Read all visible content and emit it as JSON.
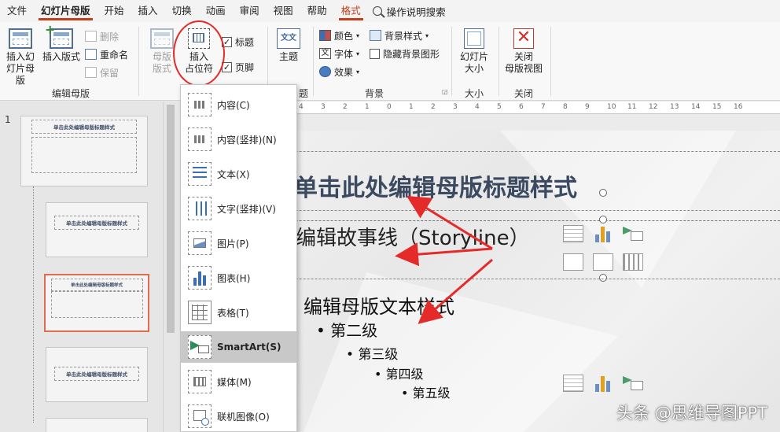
{
  "tabs": [
    "文件",
    "幻灯片母版",
    "开始",
    "插入",
    "切换",
    "动画",
    "审阅",
    "视图",
    "帮助",
    "格式"
  ],
  "active_tab": "幻灯片母版",
  "tell_me": "操作说明搜索",
  "ribbon": {
    "edit_master": {
      "insert_slide_master": "插入幻\n灯片母版",
      "insert_layout": "插入版式",
      "delete": "删除",
      "rename": "重命名",
      "preserve": "保留",
      "label": "编辑母版"
    },
    "master_layout": {
      "master_layout_btn": "母版\n版式",
      "insert_placeholder": "插入\n占位符",
      "title_checkbox": "标题",
      "footer_checkbox": "页脚",
      "title_checked": true,
      "footer_checked": true
    },
    "edit_theme": {
      "themes": "主题",
      "label": "题"
    },
    "background": {
      "colors": "颜色",
      "fonts": "字体",
      "effects": "效果",
      "background_styles": "背景样式",
      "hide_background": "隐藏背景图形",
      "label": "背景"
    },
    "size": {
      "slide_size": "幻灯片\n大小",
      "label": "大小"
    },
    "close": {
      "close_master_view": "关闭\n母版视图",
      "label": "关闭"
    }
  },
  "dropdown_items": [
    {
      "label": "内容(C)",
      "icon": "content-placeholder-icon"
    },
    {
      "label": "内容(竖排)(N)",
      "icon": "vertical-content-placeholder-icon"
    },
    {
      "label": "文本(X)",
      "icon": "text-placeholder-icon"
    },
    {
      "label": "文字(竖排)(V)",
      "icon": "vertical-text-placeholder-icon"
    },
    {
      "label": "图片(P)",
      "icon": "picture-placeholder-icon"
    },
    {
      "label": "图表(H)",
      "icon": "chart-placeholder-icon"
    },
    {
      "label": "表格(T)",
      "icon": "table-placeholder-icon"
    },
    {
      "label": "SmartArt(S)",
      "icon": "smartart-placeholder-icon"
    },
    {
      "label": "媒体(M)",
      "icon": "media-placeholder-icon"
    },
    {
      "label": "联机图像(O)",
      "icon": "online-image-placeholder-icon"
    }
  ],
  "highlighted_item": "SmartArt(S)",
  "slide_panel": {
    "slide_number": "1",
    "thumb_title": "单击此处编辑母版标题样式",
    "thumb_title_2": "单击此处编辑母版标题样式"
  },
  "ruler_ticks": [
    "4",
    "3",
    "2",
    "1",
    "0",
    "1",
    "2",
    "3",
    "4",
    "5",
    "6",
    "7",
    "8",
    "9",
    "10",
    "11",
    "12",
    "13",
    "14",
    "15",
    "16"
  ],
  "slide": {
    "title": "单击此处编辑母版标题样式",
    "storyline": "编辑故事线（Storyline）",
    "level1": "编辑母版文本样式",
    "level2": "第二级",
    "level3": "第三级",
    "level4": "第四级",
    "level5": "第五级"
  },
  "watermark": "头条 @思维导图PPT",
  "colors": {
    "accent": "#c43e1c",
    "annotation_red": "#e52a2a",
    "title_text": "#3b4a60",
    "selection_border": "#e06d49"
  }
}
